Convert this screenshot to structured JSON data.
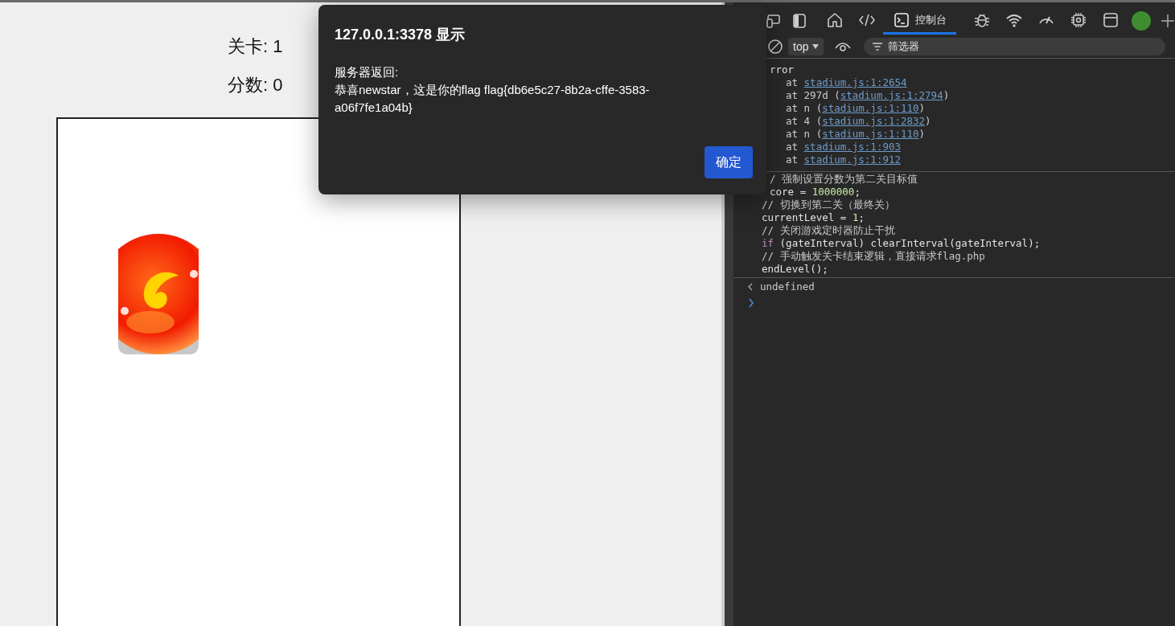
{
  "page": {
    "level_label": "关卡: 1",
    "score_label": "分数: 0"
  },
  "dialog": {
    "title": "127.0.0.1:3378 显示",
    "message_lines": [
      "服务器返回:",
      "恭喜newstar，这是你的flag flag{db6e5c27-8b2a-cffe-3583-",
      "a06f7fe1a04b}"
    ],
    "button": "确定"
  },
  "devtools": {
    "tabs": [
      {
        "selected": false
      },
      {
        "selected": false
      },
      {
        "label": "控制台",
        "selected": true
      },
      {
        "selected": false
      },
      {
        "selected": false
      },
      {
        "selected": false
      },
      {
        "selected": false
      },
      {
        "selected": false
      }
    ],
    "context": "top",
    "filter": {
      "placeholder": "筛选器"
    },
    "error": {
      "text": "rror",
      "frames": [
        {
          "prefix": "at ",
          "link": "stadium.js:1:2654"
        },
        {
          "prefix": "at 297d (",
          "link": "stadium.js:1:2794",
          "suffix": ")"
        },
        {
          "prefix": "at n (",
          "link": "stadium.js:1:110",
          "suffix": ")"
        },
        {
          "prefix": "at 4 (",
          "link": "stadium.js:1:2832",
          "suffix": ")"
        },
        {
          "prefix": "at n (",
          "link": "stadium.js:1:110",
          "suffix": ")"
        },
        {
          "prefix": "at ",
          "link": "stadium.js:1:903"
        },
        {
          "prefix": "at ",
          "link": "stadium.js:1:912"
        }
      ]
    },
    "input_lines": [
      {
        "cut": true,
        "segments": [
          {
            "kind": "comment",
            "text": "/ 强制设置分数为第二关目标值"
          }
        ]
      },
      {
        "cut": true,
        "segments": [
          {
            "kind": "plain",
            "text": "core = "
          },
          {
            "kind": "number",
            "text": "1000000"
          },
          {
            "kind": "plain",
            "text": ";"
          }
        ]
      },
      {
        "cut": false,
        "segments": [
          {
            "kind": "comment",
            "text": "// 切换到第二关（最终关）"
          }
        ]
      },
      {
        "cut": false,
        "segments": [
          {
            "kind": "plain",
            "text": "currentLevel = "
          },
          {
            "kind": "number",
            "text": "1"
          },
          {
            "kind": "plain",
            "text": ";"
          }
        ]
      },
      {
        "cut": false,
        "segments": [
          {
            "kind": "comment",
            "text": "// 关闭游戏定时器防止干扰"
          }
        ]
      },
      {
        "cut": false,
        "segments": [
          {
            "kind": "keyword",
            "text": "if"
          },
          {
            "kind": "plain",
            "text": " (gateInterval) clearInterval(gateInterval);"
          }
        ]
      },
      {
        "cut": false,
        "segments": [
          {
            "kind": "comment",
            "text": "// 手动触发关卡结束逻辑，直接请求flag.php"
          }
        ]
      },
      {
        "cut": false,
        "segments": [
          {
            "kind": "plain",
            "text": "endLevel();"
          }
        ]
      }
    ],
    "result": "undefined"
  }
}
